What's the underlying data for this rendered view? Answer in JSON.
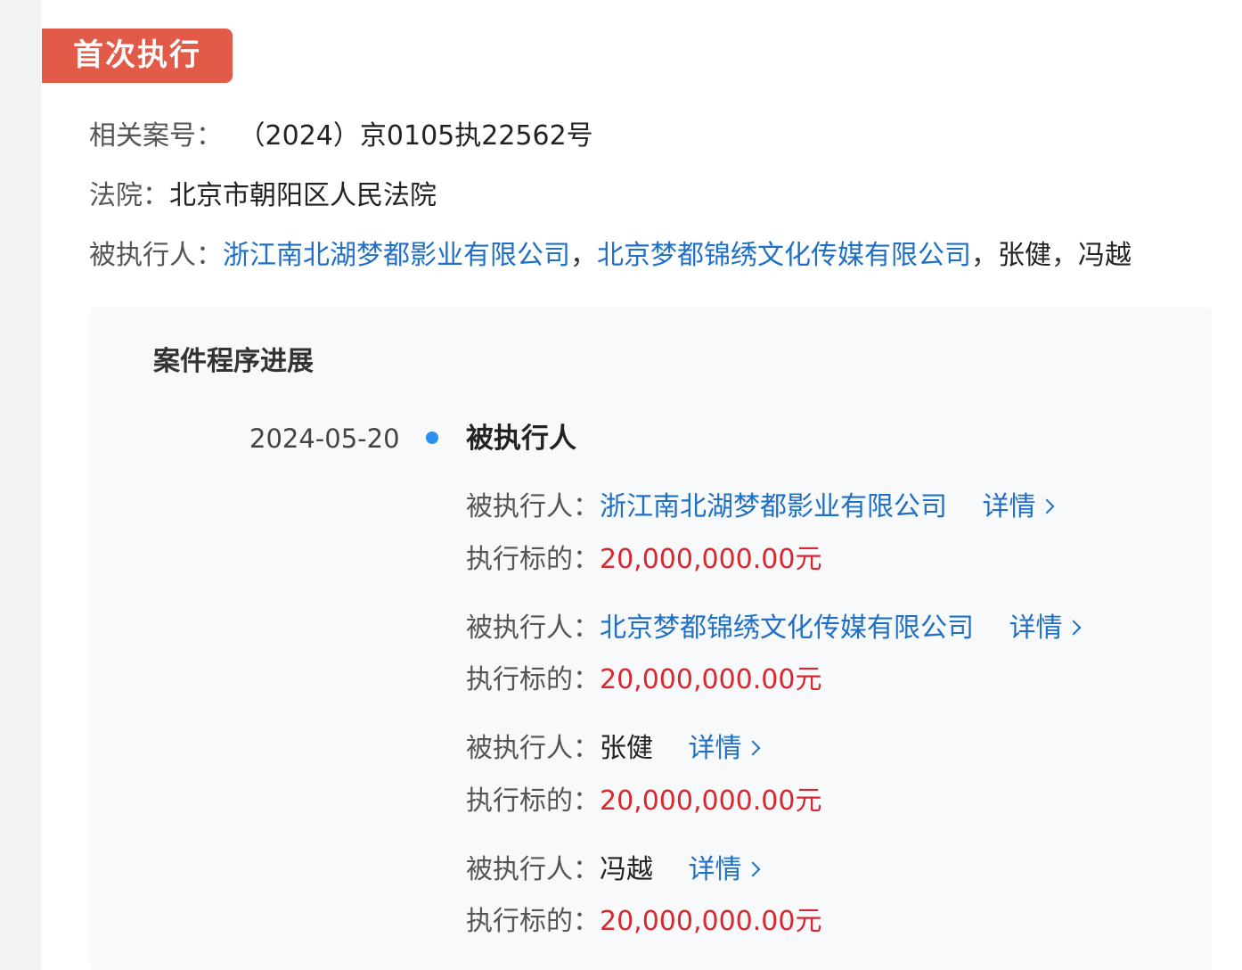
{
  "tag": "首次执行",
  "case": {
    "case_no_label": "相关案号：",
    "case_no": "（2024）京0105执22562号",
    "court_label": "法院：",
    "court": "北京市朝阳区人民法院",
    "executed_label": "被执行人：",
    "executed": [
      "浙江南北湖梦都影业有限公司",
      "北京梦都锦绣文化传媒有限公司",
      "张健",
      "冯越"
    ],
    "separator": "，"
  },
  "progress": {
    "title": "案件程序进展",
    "date": "2024-05-20",
    "event": "被执行人",
    "person_label": "被执行人：",
    "amount_label": "执行标的：",
    "detail_label": "详情",
    "entries": [
      {
        "name": "浙江南北湖梦都影业有限公司",
        "amount": "20,000,000.00元"
      },
      {
        "name": "北京梦都锦绣文化传媒有限公司",
        "amount": "20,000,000.00元"
      },
      {
        "name": "张健",
        "amount": "20,000,000.00元"
      },
      {
        "name": "冯越",
        "amount": "20,000,000.00元"
      }
    ]
  },
  "colors": {
    "tag_bg": "#e25a48",
    "link": "#1f6fc5",
    "amount": "#d7282f",
    "dot": "#2a8ff0"
  }
}
